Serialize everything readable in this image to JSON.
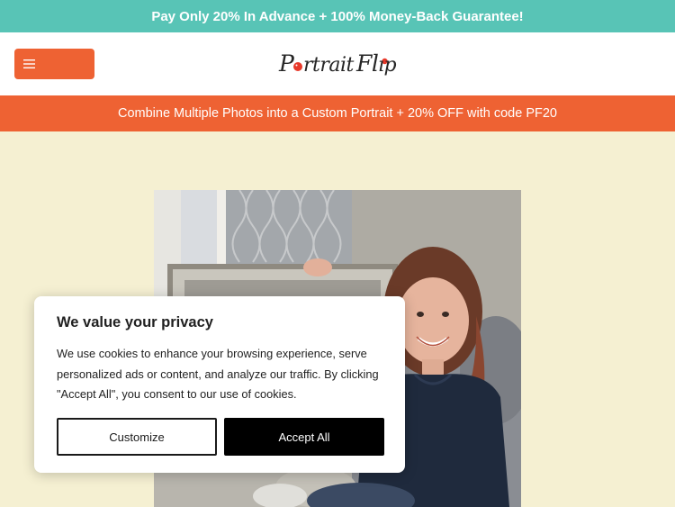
{
  "top_banner": {
    "text": "Pay Only 20% In Advance + 100% Money-Back Guarantee!"
  },
  "header": {
    "menu_icon": "hamburger-icon",
    "logo_text": "Portrait Flip"
  },
  "promo_bar": {
    "text": "Combine Multiple Photos into a Custom Portrait + 20% OFF with code PF20"
  },
  "cookie_banner": {
    "title": "We value your privacy",
    "body": "We use cookies to enhance your browsing experience, serve personalized ads or content, and analyze our traffic. By clicking \"Accept All\", you consent to our use of cookies.",
    "customize_label": "Customize",
    "accept_label": "Accept All"
  },
  "colors": {
    "teal": "#58c4b6",
    "orange": "#ee6233",
    "cream_bg": "#f5f0d2"
  }
}
